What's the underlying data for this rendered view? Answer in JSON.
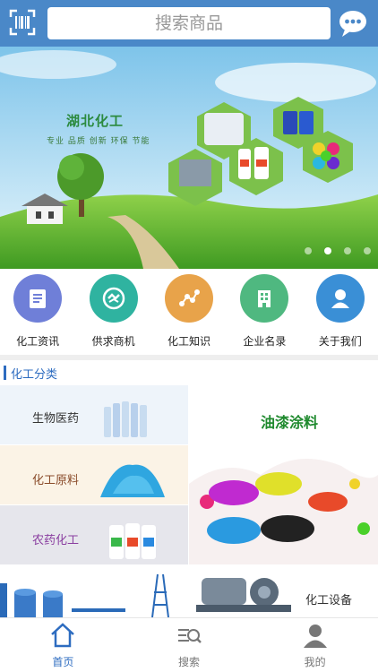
{
  "header": {
    "search_placeholder": "搜索商品",
    "scan_icon": "scan-icon",
    "chat_icon": "chat-bubble-icon"
  },
  "banner": {
    "title": "湖北化工",
    "slogan": "专业  品质  创新  环保  节能",
    "slides_total": 4,
    "active_slide": 2
  },
  "quicknav": [
    {
      "label": "化工资讯",
      "icon": "document-icon",
      "color": "#6f7fd8"
    },
    {
      "label": "供求商机",
      "icon": "handshake-icon",
      "color": "#2fb3a0"
    },
    {
      "label": "化工知识",
      "icon": "molecule-icon",
      "color": "#e8a34a"
    },
    {
      "label": "企业名录",
      "icon": "building-icon",
      "color": "#4fb880"
    },
    {
      "label": "关于我们",
      "icon": "person-icon",
      "color": "#3a8fd6"
    }
  ],
  "categories": {
    "title": "化工分类",
    "items": [
      {
        "label": "生物医药",
        "color": "#333333"
      },
      {
        "label": "化工原料",
        "color": "#8a4b2a"
      },
      {
        "label": "农药化工",
        "color": "#8a3ea0"
      },
      {
        "label": "油漆涂料",
        "color": "#1f8a2e"
      },
      {
        "label": "化工设备",
        "color": "#333333"
      }
    ]
  },
  "tabbar": [
    {
      "label": "首页",
      "icon": "home-icon",
      "active": true
    },
    {
      "label": "搜索",
      "icon": "search-list-icon",
      "active": false
    },
    {
      "label": "我的",
      "icon": "user-icon",
      "active": false
    }
  ],
  "colors": {
    "brand_blue": "#4a88c8",
    "active_tab": "#2d6cc0",
    "inactive_tab": "#777777"
  }
}
